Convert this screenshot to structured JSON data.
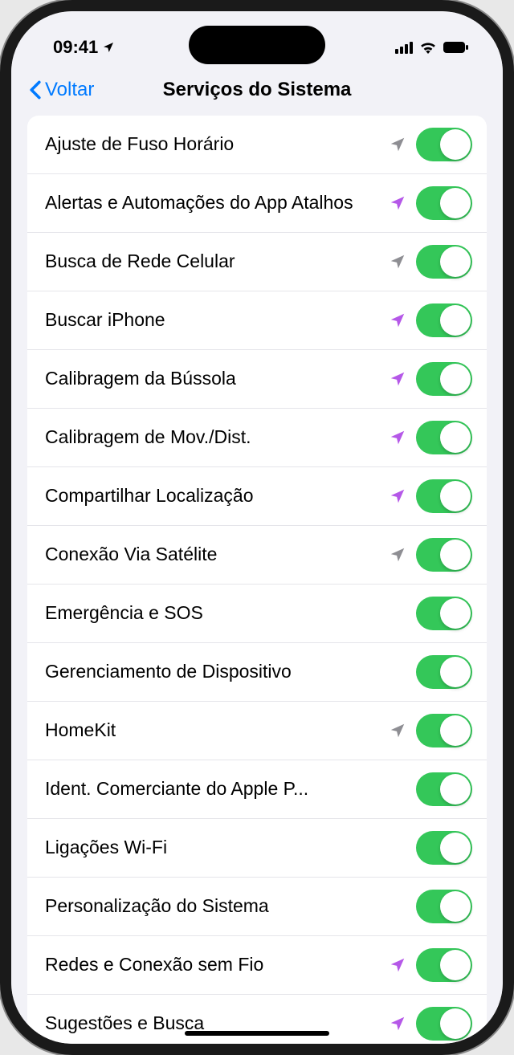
{
  "status_bar": {
    "time": "09:41"
  },
  "nav": {
    "back_label": "Voltar",
    "title": "Serviços do Sistema"
  },
  "colors": {
    "arrow_gray": "#8e8e93",
    "arrow_purple": "#b558e8",
    "toggle_on": "#34c759",
    "link_blue": "#007aff"
  },
  "services": [
    {
      "label": "Ajuste de Fuso Horário",
      "arrow": "gray",
      "on": true
    },
    {
      "label": "Alertas e Automações do App Atalhos",
      "arrow": "purple",
      "on": true
    },
    {
      "label": "Busca de Rede Celular",
      "arrow": "gray",
      "on": true
    },
    {
      "label": "Buscar iPhone",
      "arrow": "purple",
      "on": true
    },
    {
      "label": "Calibragem da Bússola",
      "arrow": "purple",
      "on": true
    },
    {
      "label": "Calibragem de Mov./Dist.",
      "arrow": "purple",
      "on": true
    },
    {
      "label": "Compartilhar Localização",
      "arrow": "purple",
      "on": true
    },
    {
      "label": "Conexão Via Satélite",
      "arrow": "gray",
      "on": true
    },
    {
      "label": "Emergência e SOS",
      "arrow": null,
      "on": true
    },
    {
      "label": "Gerenciamento de Dispositivo",
      "arrow": null,
      "on": true
    },
    {
      "label": "HomeKit",
      "arrow": "gray",
      "on": true
    },
    {
      "label": "Ident. Comerciante do Apple P...",
      "arrow": null,
      "on": true,
      "truncate": true
    },
    {
      "label": "Ligações Wi-Fi",
      "arrow": null,
      "on": true
    },
    {
      "label": "Personalização do Sistema",
      "arrow": null,
      "on": true
    },
    {
      "label": "Redes e Conexão sem Fio",
      "arrow": "purple",
      "on": true
    },
    {
      "label": "Sugestões e Busca",
      "arrow": "purple",
      "on": true
    }
  ]
}
